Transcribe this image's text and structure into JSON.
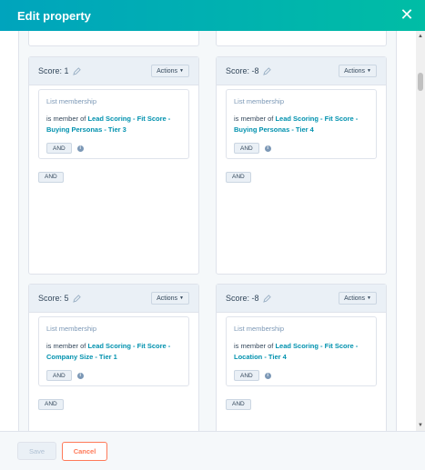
{
  "dialog": {
    "title": "Edit property"
  },
  "icons": {
    "close": "close-icon",
    "edit": "pencil-icon",
    "info": "info-icon",
    "caret": "chevron-down-icon"
  },
  "colors": {
    "header_start": "#00a4bd",
    "header_end": "#00bda5",
    "link": "#0091ae",
    "cancel": "#ff7a59"
  },
  "common": {
    "actions_label": "Actions",
    "filter_type": "List membership",
    "is_member_of": "is member of ",
    "and_label": "AND"
  },
  "cards": [
    {
      "score": "Score: 1",
      "list_name": "Lead Scoring - Fit Score - Buying Personas - Tier 3"
    },
    {
      "score": "Score: -8",
      "list_name": "Lead Scoring - Fit Score - Buying Personas - Tier 4"
    },
    {
      "score": "Score: 5",
      "list_name": "Lead Scoring - Fit Score - Company Size - Tier 1"
    },
    {
      "score": "Score: -8",
      "list_name": "Lead Scoring - Fit Score - Location - Tier 4"
    }
  ],
  "footer": {
    "save_label": "Save",
    "cancel_label": "Cancel"
  }
}
